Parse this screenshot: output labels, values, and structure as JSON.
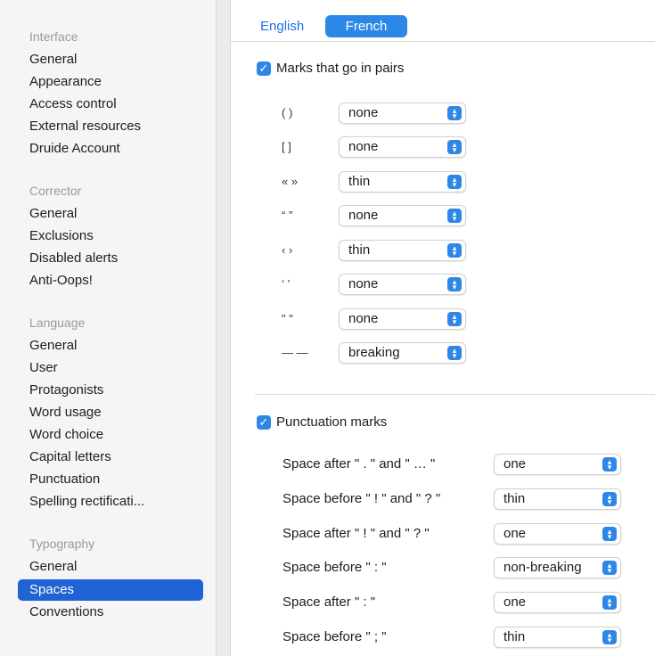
{
  "sidebar": {
    "groups": [
      {
        "header": "Interface",
        "items": [
          "General",
          "Appearance",
          "Access control",
          "External resources",
          "Druide Account"
        ]
      },
      {
        "header": "Corrector",
        "items": [
          "General",
          "Exclusions",
          "Disabled alerts",
          "Anti-Oops!"
        ]
      },
      {
        "header": "Language",
        "items": [
          "General",
          "User",
          "Protagonists",
          "Word usage",
          "Word choice",
          "Capital letters",
          "Punctuation",
          "Spelling rectificati..."
        ]
      },
      {
        "header": "Typography",
        "items": [
          "General",
          "Spaces",
          "Conventions"
        ]
      }
    ],
    "selected": "Spaces",
    "accent_color": "#1f63d4"
  },
  "tabs": {
    "english": "English",
    "french": "French",
    "active": "French"
  },
  "pairs_section": {
    "checked": true,
    "label": "Marks that go in pairs",
    "rows": [
      {
        "mark": "( )",
        "value": "none"
      },
      {
        "mark": "[ ]",
        "value": "none"
      },
      {
        "mark": "« »",
        "value": "thin"
      },
      {
        "mark": "“ ”",
        "value": "none"
      },
      {
        "mark": "‹ ›",
        "value": "thin"
      },
      {
        "mark": "‘ ’",
        "value": "none"
      },
      {
        "mark": "\" \"",
        "value": "none"
      },
      {
        "mark": "— —",
        "value": "breaking"
      }
    ]
  },
  "punct_section": {
    "checked": true,
    "label": "Punctuation marks",
    "rows": [
      {
        "label": "Space after \" . \" and \" … \"",
        "value": "one"
      },
      {
        "label": "Space before \" ! \" and \" ? \"",
        "value": "thin"
      },
      {
        "label": "Space after \" ! \" and \" ? \"",
        "value": "one"
      },
      {
        "label": "Space before \" : \"",
        "value": "non-breaking"
      },
      {
        "label": "Space after \" : \"",
        "value": "one"
      },
      {
        "label": "Space before \" ; \"",
        "value": "thin"
      }
    ]
  },
  "icons": {
    "checkbox": "checkmark-icon",
    "select": "up-down-chevron-icon"
  }
}
